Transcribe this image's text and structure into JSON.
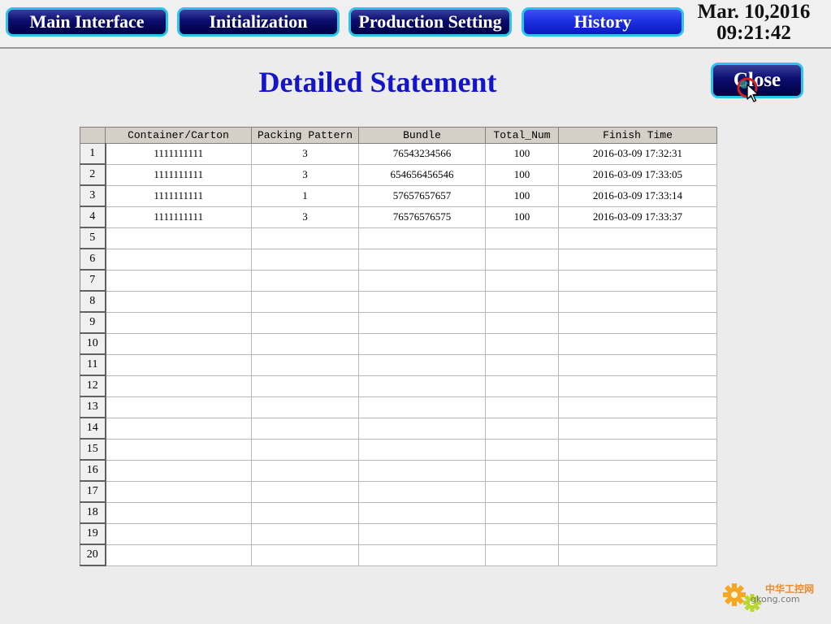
{
  "nav": {
    "main_interface": "Main Interface",
    "initialization": "Initialization",
    "production_setting": "Production Setting",
    "history": "History"
  },
  "clock": {
    "date": "Mar. 10,2016",
    "time": "09:21:42"
  },
  "page": {
    "title": "Detailed Statement",
    "close_label": "Close"
  },
  "table": {
    "columns": [
      "Container/Carton",
      "Packing Pattern",
      "Bundle",
      "Total_Num",
      "Finish Time"
    ],
    "rows": [
      {
        "num": "1",
        "cells": [
          "1111111111",
          "3",
          "76543234566",
          "100",
          "2016-03-09 17:32:31"
        ]
      },
      {
        "num": "2",
        "cells": [
          "1111111111",
          "3",
          "654656456546",
          "100",
          "2016-03-09 17:33:05"
        ]
      },
      {
        "num": "3",
        "cells": [
          "1111111111",
          "1",
          "57657657657",
          "100",
          "2016-03-09 17:33:14"
        ]
      },
      {
        "num": "4",
        "cells": [
          "1111111111",
          "3",
          "76576576575",
          "100",
          "2016-03-09 17:33:37"
        ]
      },
      {
        "num": "5",
        "cells": [
          "",
          "",
          "",
          "",
          ""
        ]
      },
      {
        "num": "6",
        "cells": [
          "",
          "",
          "",
          "",
          ""
        ]
      },
      {
        "num": "7",
        "cells": [
          "",
          "",
          "",
          "",
          ""
        ]
      },
      {
        "num": "8",
        "cells": [
          "",
          "",
          "",
          "",
          ""
        ]
      },
      {
        "num": "9",
        "cells": [
          "",
          "",
          "",
          "",
          ""
        ]
      },
      {
        "num": "10",
        "cells": [
          "",
          "",
          "",
          "",
          ""
        ]
      },
      {
        "num": "11",
        "cells": [
          "",
          "",
          "",
          "",
          ""
        ]
      },
      {
        "num": "12",
        "cells": [
          "",
          "",
          "",
          "",
          ""
        ]
      },
      {
        "num": "13",
        "cells": [
          "",
          "",
          "",
          "",
          ""
        ]
      },
      {
        "num": "14",
        "cells": [
          "",
          "",
          "",
          "",
          ""
        ]
      },
      {
        "num": "15",
        "cells": [
          "",
          "",
          "",
          "",
          ""
        ]
      },
      {
        "num": "16",
        "cells": [
          "",
          "",
          "",
          "",
          ""
        ]
      },
      {
        "num": "17",
        "cells": [
          "",
          "",
          "",
          "",
          ""
        ]
      },
      {
        "num": "18",
        "cells": [
          "",
          "",
          "",
          "",
          ""
        ]
      },
      {
        "num": "19",
        "cells": [
          "",
          "",
          "",
          "",
          ""
        ]
      },
      {
        "num": "20",
        "cells": [
          "",
          "",
          "",
          "",
          ""
        ]
      }
    ]
  },
  "watermark": {
    "brand": "中华工控网",
    "site": "gkong.com"
  },
  "colors": {
    "title_blue": "#1515c8",
    "button_navy": "#0a0d6e",
    "button_active": "#1a2ee0",
    "button_border": "#2ec3e8",
    "header_gray": "#d4d0c8"
  },
  "icons": {
    "cursor": "mouse-pointer-icon",
    "busy": "busy-ring-icon",
    "logo": "gear-logo-icon"
  }
}
